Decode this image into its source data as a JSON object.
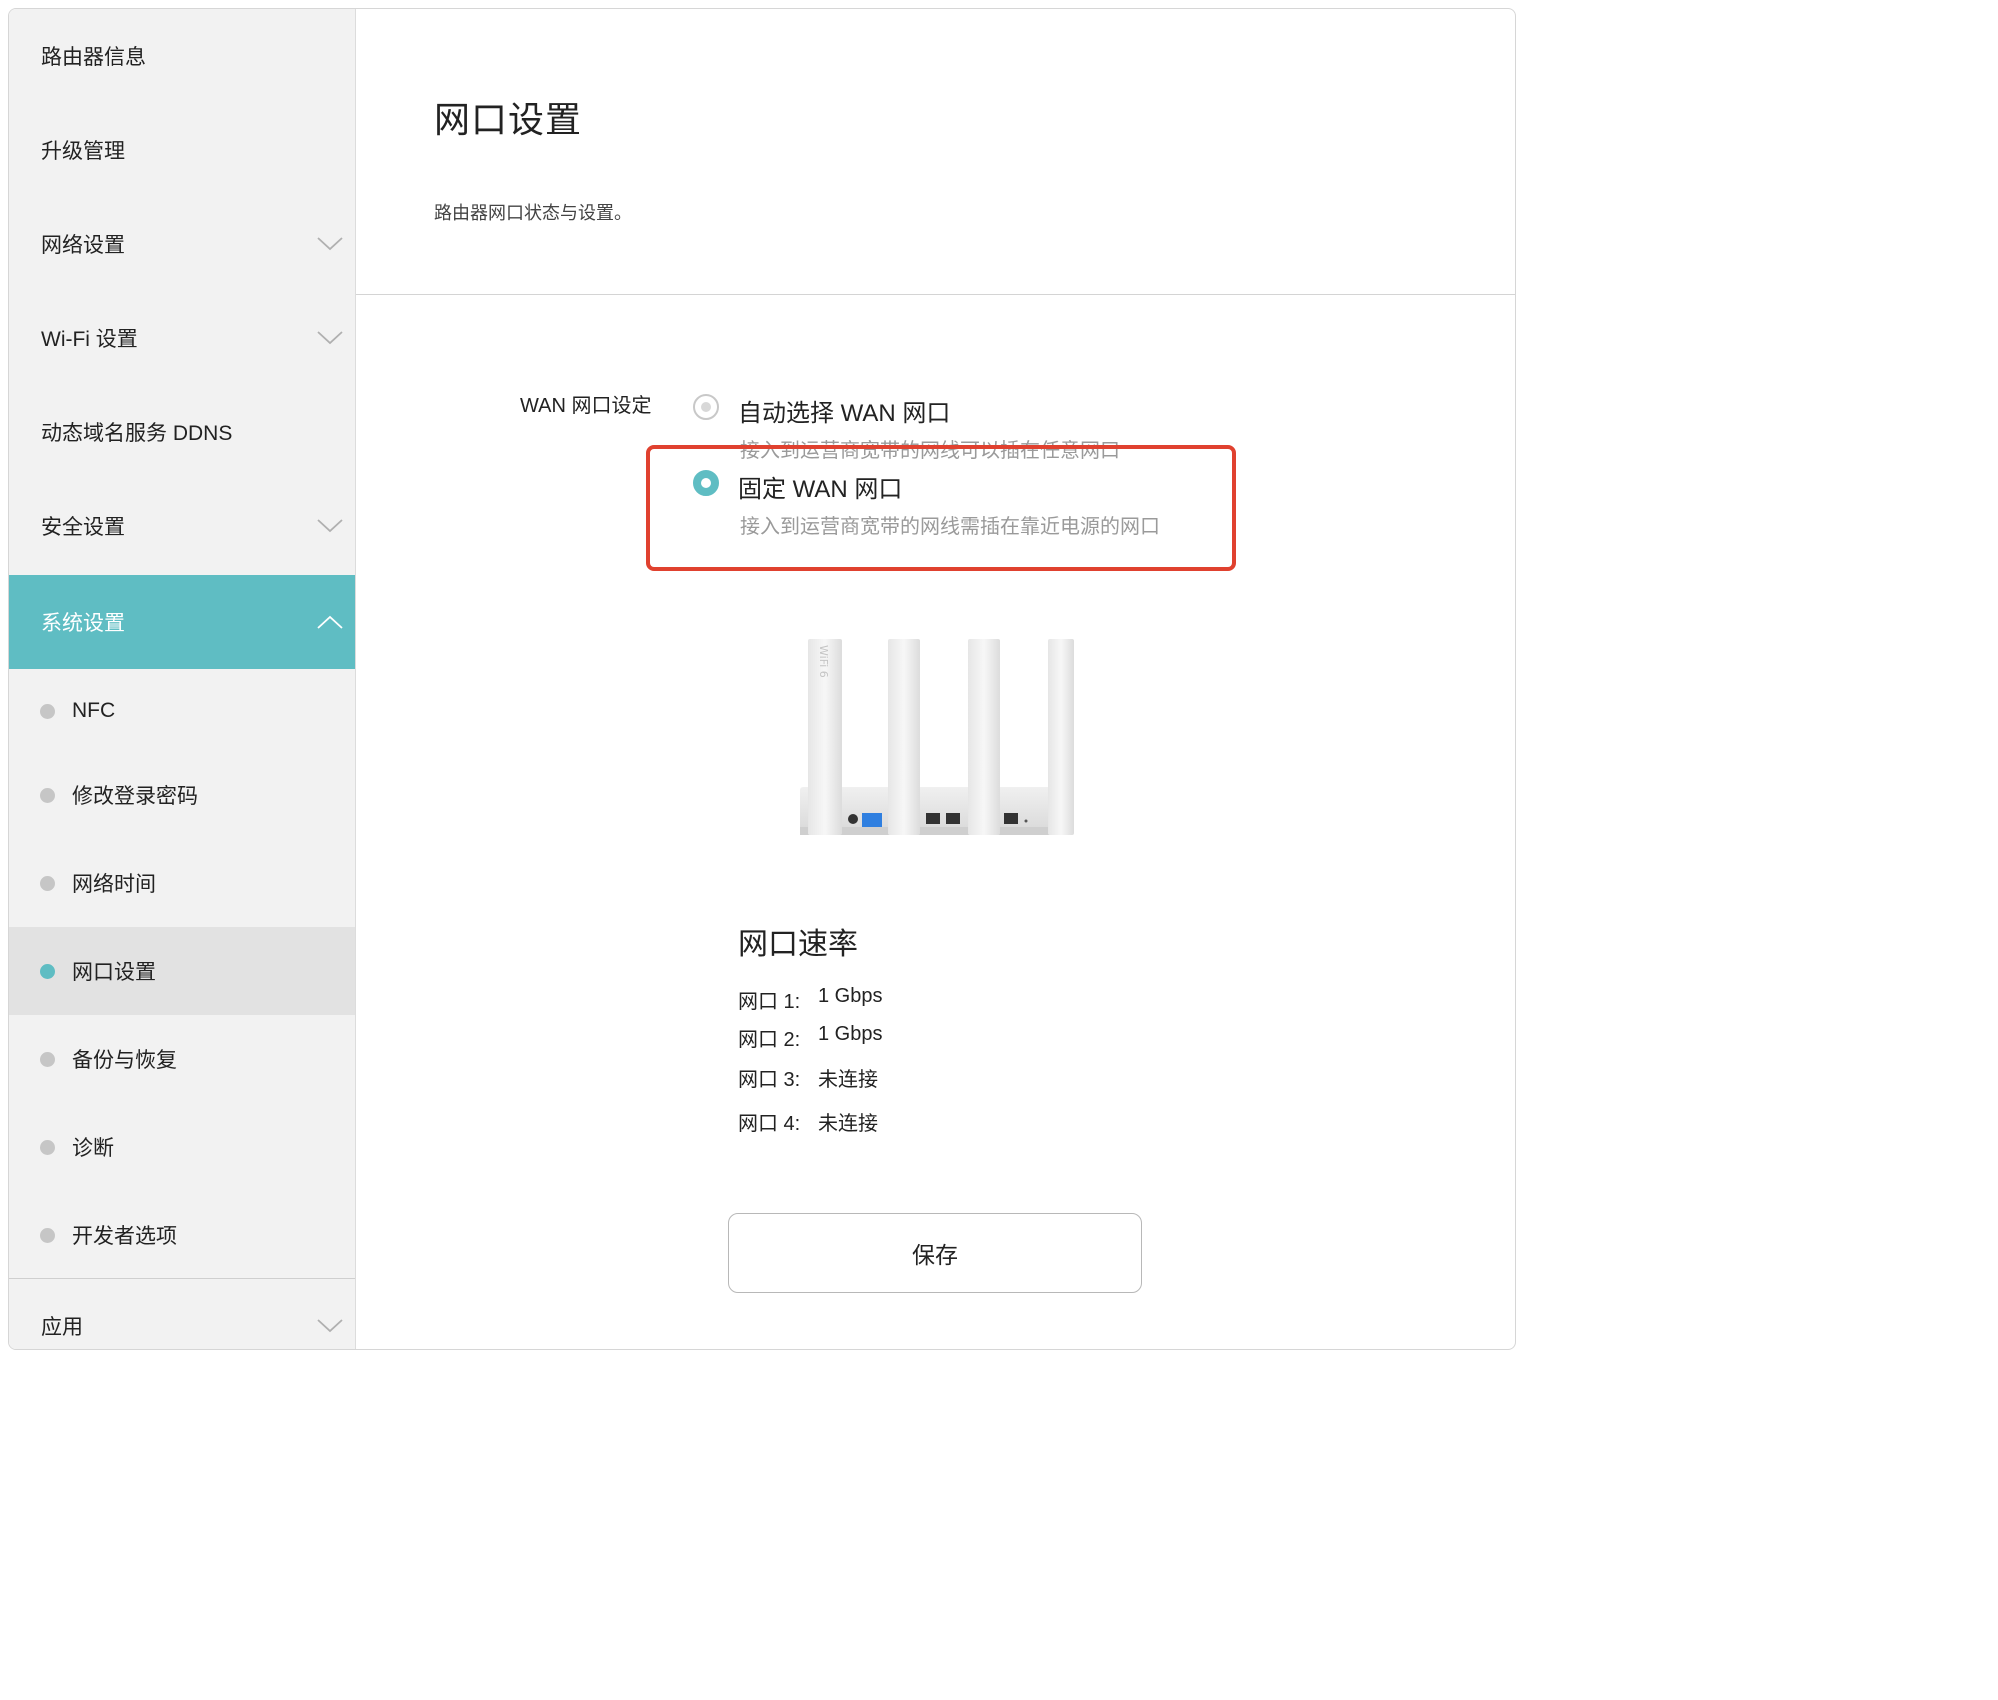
{
  "sidebar": {
    "items": [
      {
        "label": "路由器信息",
        "has_chevron": false
      },
      {
        "label": "升级管理",
        "has_chevron": false
      },
      {
        "label": "网络设置",
        "has_chevron": true
      },
      {
        "label": "Wi-Fi 设置",
        "has_chevron": true
      },
      {
        "label": "动态域名服务 DDNS",
        "has_chevron": false
      },
      {
        "label": "安全设置",
        "has_chevron": true
      },
      {
        "label": "系统设置",
        "has_chevron": true,
        "active": true
      }
    ],
    "sub_items": [
      {
        "label": "NFC"
      },
      {
        "label": "修改登录密码"
      },
      {
        "label": "网络时间"
      },
      {
        "label": "网口设置",
        "selected": true
      },
      {
        "label": "备份与恢复"
      },
      {
        "label": "诊断"
      },
      {
        "label": "开发者选项"
      }
    ],
    "bottom_item": {
      "label": "应用"
    }
  },
  "page": {
    "title": "网口设置",
    "description": "路由器网口状态与设置。"
  },
  "wan": {
    "label": "WAN 网口设定",
    "options": [
      {
        "title": "自动选择 WAN 网口",
        "desc": "接入到运营商宽带的网线可以插在任意网口",
        "selected": false
      },
      {
        "title": "固定 WAN 网口",
        "desc": "接入到运营商宽带的网线需插在靠近电源的网口",
        "selected": true
      }
    ]
  },
  "speed": {
    "title": "网口速率",
    "rows": [
      {
        "label": "网口 1:",
        "value": "1 Gbps"
      },
      {
        "label": "网口 2:",
        "value": "1 Gbps"
      },
      {
        "label": "网口 3:",
        "value": "未连接"
      },
      {
        "label": "网口 4:",
        "value": "未连接"
      }
    ]
  },
  "router_image": {
    "side_text": "WiFi 6"
  },
  "actions": {
    "save_label": "保存"
  },
  "colors": {
    "accent": "#5fbdc3",
    "highlight": "#e0412f",
    "sidebar_bg": "#f2f2f2"
  },
  "icons": {
    "chevron_down": "chevron-down-icon",
    "chevron_up": "chevron-up-icon"
  }
}
